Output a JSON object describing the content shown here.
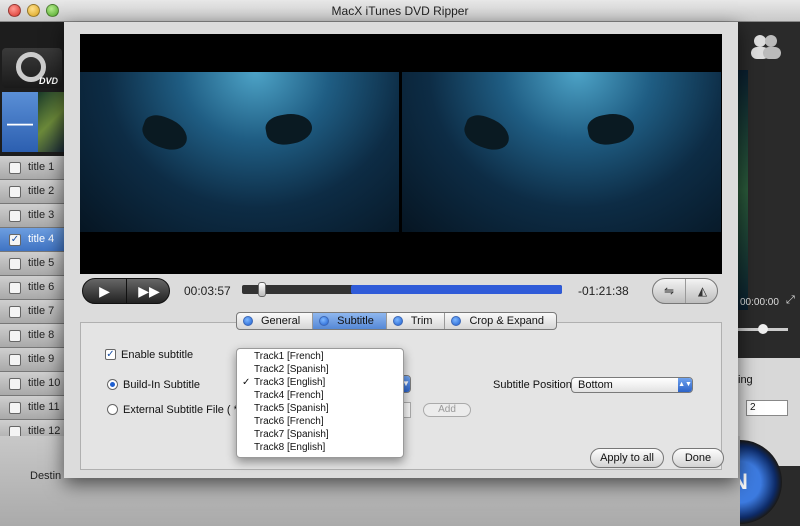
{
  "window": {
    "title": "MacX iTunes DVD Ripper"
  },
  "app": {
    "dvd_label": "DVD",
    "minus_label": "—",
    "titles": [
      {
        "label": "title 1",
        "checked": false
      },
      {
        "label": "title 2",
        "checked": false
      },
      {
        "label": "title 3",
        "checked": false
      },
      {
        "label": "title 4",
        "checked": true
      },
      {
        "label": "title 5",
        "checked": false
      },
      {
        "label": "title 6",
        "checked": false
      },
      {
        "label": "title 7",
        "checked": false
      },
      {
        "label": "title 8",
        "checked": false
      },
      {
        "label": "title 9",
        "checked": false
      },
      {
        "label": "title 10",
        "checked": false
      },
      {
        "label": "title 11",
        "checked": false
      },
      {
        "label": "title 12",
        "checked": false
      }
    ],
    "right_time": "00:00:00",
    "right_panel_text": "ing",
    "right_select_value": "2",
    "run_label": "N",
    "destination_label": "Destin"
  },
  "player": {
    "play_icon": "▶",
    "ff_icon": "▶▶",
    "current_time": "00:03:57",
    "remaining_time": "-01:21:38",
    "progress_fraction": 0.34,
    "knob_fraction": 0.05,
    "flip_h_icon": "⇋",
    "flip_v_icon": "◭"
  },
  "tabs": [
    {
      "label": "General",
      "active": false
    },
    {
      "label": "Subtitle",
      "active": true
    },
    {
      "label": "Trim",
      "active": false
    },
    {
      "label": "Crop & Expand",
      "active": false
    }
  ],
  "subtitle": {
    "enable_label": "Enable subtitle",
    "enable_checked": true,
    "buildin_label": "Build-In Subtitle",
    "external_label": "External Subtitle File ( *.srt)",
    "add_label": "Add",
    "position_label": "Subtitle Position:",
    "position_value": "Bottom",
    "track_options": [
      {
        "label": "Track1 [French]",
        "selected": false
      },
      {
        "label": "Track2 [Spanish]",
        "selected": false
      },
      {
        "label": "Track3 [English]",
        "selected": true
      },
      {
        "label": "Track4 [French]",
        "selected": false
      },
      {
        "label": "Track5 [Spanish]",
        "selected": false
      },
      {
        "label": "Track6 [French]",
        "selected": false
      },
      {
        "label": "Track7 [Spanish]",
        "selected": false
      },
      {
        "label": "Track8 [English]",
        "selected": false
      }
    ]
  },
  "buttons": {
    "apply_all": "Apply to all",
    "done": "Done"
  },
  "colors": {
    "accent": "#2f5bd8",
    "selected_row": "#3f73c3"
  }
}
